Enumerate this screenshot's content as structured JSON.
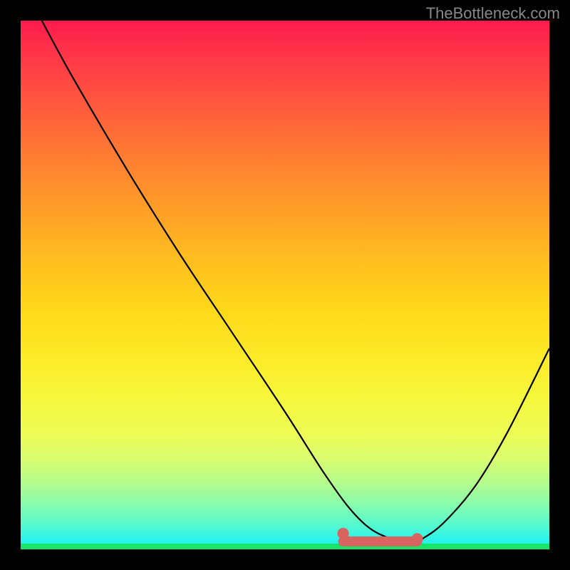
{
  "watermark": "TheBottleneck.com",
  "chart_data": {
    "type": "line",
    "title": "",
    "xlabel": "",
    "ylabel": "",
    "xlim": [
      0,
      100
    ],
    "ylim": [
      0,
      100
    ],
    "series": [
      {
        "name": "bottleneck-curve",
        "x": [
          4,
          10,
          20,
          30,
          40,
          50,
          57,
          62,
          66,
          70,
          74,
          76,
          80,
          86,
          92,
          100
        ],
        "values": [
          100,
          89,
          72,
          56,
          41,
          26,
          15,
          8,
          4,
          2,
          1,
          2,
          5,
          12,
          22,
          38
        ]
      }
    ],
    "markers": [
      {
        "name": "zone-start",
        "x": 61,
        "y": 3,
        "color": "#d9645f"
      },
      {
        "name": "zone-end",
        "x": 75,
        "y": 2,
        "color": "#d9645f"
      }
    ],
    "optimal_zone": {
      "x_start": 61,
      "x_end": 75
    },
    "background_gradient": {
      "top": "#ff1a4d",
      "mid": "#ffd91a",
      "bottom": "#14efdf"
    }
  }
}
